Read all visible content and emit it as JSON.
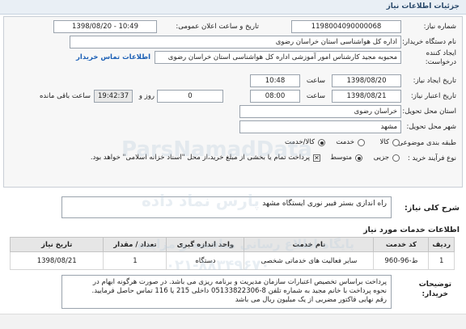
{
  "header": {
    "title": "جزئیات اطلاعات نیاز"
  },
  "form": {
    "need_number": {
      "label": "شماره نیاز:",
      "value": "1198004090000068"
    },
    "announce_datetime": {
      "label": "تاریخ و ساعت اعلان عمومی:",
      "value": "1398/08/20 - 10:49"
    },
    "buyer_org": {
      "label": "نام دستگاه خریدار:",
      "value": "اداره کل هواشناسی استان خراسان رضوی"
    },
    "requester": {
      "label_line1": "ایجاد کننده",
      "label_line2": "درخواست:",
      "value": "محبوبه مجید کارشناس امور آموزشی اداره کل هواشناسی استان خراسان رضوی",
      "contact_link": "اطلاعات تماس خریدار"
    },
    "creation": {
      "label": "تاریخ ایجاد نیاز:",
      "date": "1398/08/20",
      "time_label": "ساعت",
      "time": "10:48"
    },
    "deadline": {
      "label": "تاریخ اعتبار نیاز:",
      "date": "1398/08/21",
      "time_label": "ساعت",
      "time": "08:00",
      "days": "0",
      "days_label": "روز و",
      "remaining": "19:42:37",
      "remaining_label": "ساعت باقی مانده"
    },
    "province": {
      "label": "استان محل تحویل:",
      "value": "خراسان رضوی"
    },
    "city": {
      "label": "شهر محل تحویل:",
      "value": "مشهد"
    },
    "category": {
      "label": "طبقه بندی موضوعی:",
      "options": [
        "کالا",
        "خدمت",
        "کالا/خدمت"
      ],
      "selected": "کالا/خدمت"
    },
    "purchase_type": {
      "label": "نوع فرآیند خرید :",
      "options": [
        "جزیی",
        "متوسط"
      ],
      "selected": "متوسط",
      "payment_note": "پرداخت تمام یا بخشی از مبلغ خرید،از محل \"اسناد خزانه اسلامی\" خواهد بود."
    }
  },
  "summary": {
    "label": "شرح کلی نیاز:",
    "value": "راه اندازی بستر فیبر نوری ایستگاه مشهد"
  },
  "services": {
    "title": "اطلاعات خدمات مورد نیاز",
    "columns": [
      "ردیف",
      "کد خدمت",
      "نام خدمت",
      "واحد اندازه گیری",
      "تعداد / مقدار",
      "تاریخ نیاز"
    ],
    "rows": [
      [
        "1",
        "ط-96-960",
        "سایر فعالیت های خدماتی شخصی",
        "دستگاه",
        "1",
        "1398/08/21"
      ]
    ]
  },
  "buyer_notes": {
    "label_line1": "توضیحات",
    "label_line2": "خریدار:",
    "lines": [
      "پرداخت براساس تخصیص اعتبارات سازمان مدیریت و برنامه ریزی می باشد. در صورت هرگونه ابهام در",
      "نحوه پرداخت با خانم مجید به شماره تلفن 8-05133822306 داخلی 215 یا 116 تماس حاصل فرمایید.",
      "رقم نهایی فاکتور مضربی از یک میلیون ریال می باشد"
    ]
  },
  "watermark": {
    "line1": "ParsNamadData",
    "line2": "پارس نماد داده",
    "line3": "پایگاه اطلاع رسانی مناقصه و مزایده",
    "line4": "۰۲۱-۸۸۳۴۹۶۷۰"
  }
}
